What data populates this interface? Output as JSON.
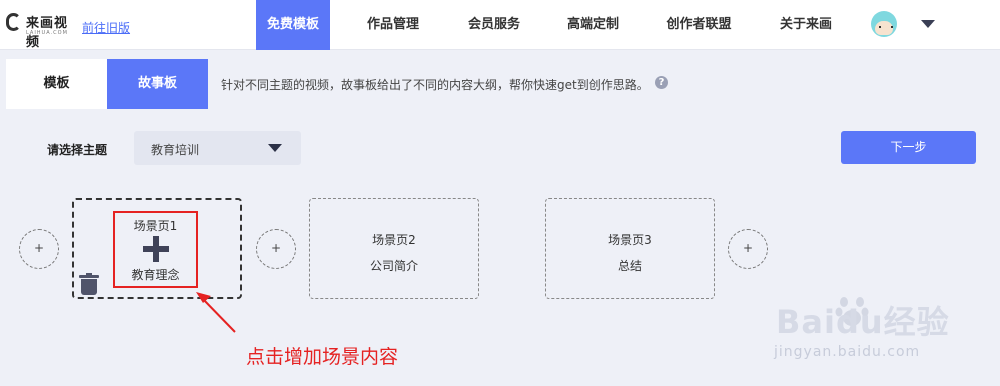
{
  "header": {
    "logo_text": "来画视频",
    "logo_sub": "LAIHUA.COM",
    "old_version_link": "前往旧版",
    "nav": [
      "免费模板",
      "作品管理",
      "会员服务",
      "高端定制",
      "创作者联盟",
      "关于来画"
    ],
    "active_nav": "免费模板"
  },
  "tabs": {
    "template_label": "模板",
    "story_label": "故事板",
    "description": "针对不同主题的视频，故事板给出了不同的内容大纲，帮你快速get到创作思路。",
    "help_icon": "?"
  },
  "theme": {
    "label": "请选择主题",
    "selected": "教育培训"
  },
  "next_button": "下一步",
  "add_label": "+",
  "scenes": [
    {
      "title": "场景页1",
      "subtitle": "教育理念"
    },
    {
      "title": "场景页2",
      "subtitle": "公司简介"
    },
    {
      "title": "场景页3",
      "subtitle": "总结"
    }
  ],
  "annotation": "点击增加场景内容",
  "watermark": {
    "text": "Baidu经验",
    "sub": "jingyan.baidu.com"
  },
  "colors": {
    "accent": "#5b77f8",
    "annotation_red": "#e52222",
    "background": "#eef0f7"
  }
}
